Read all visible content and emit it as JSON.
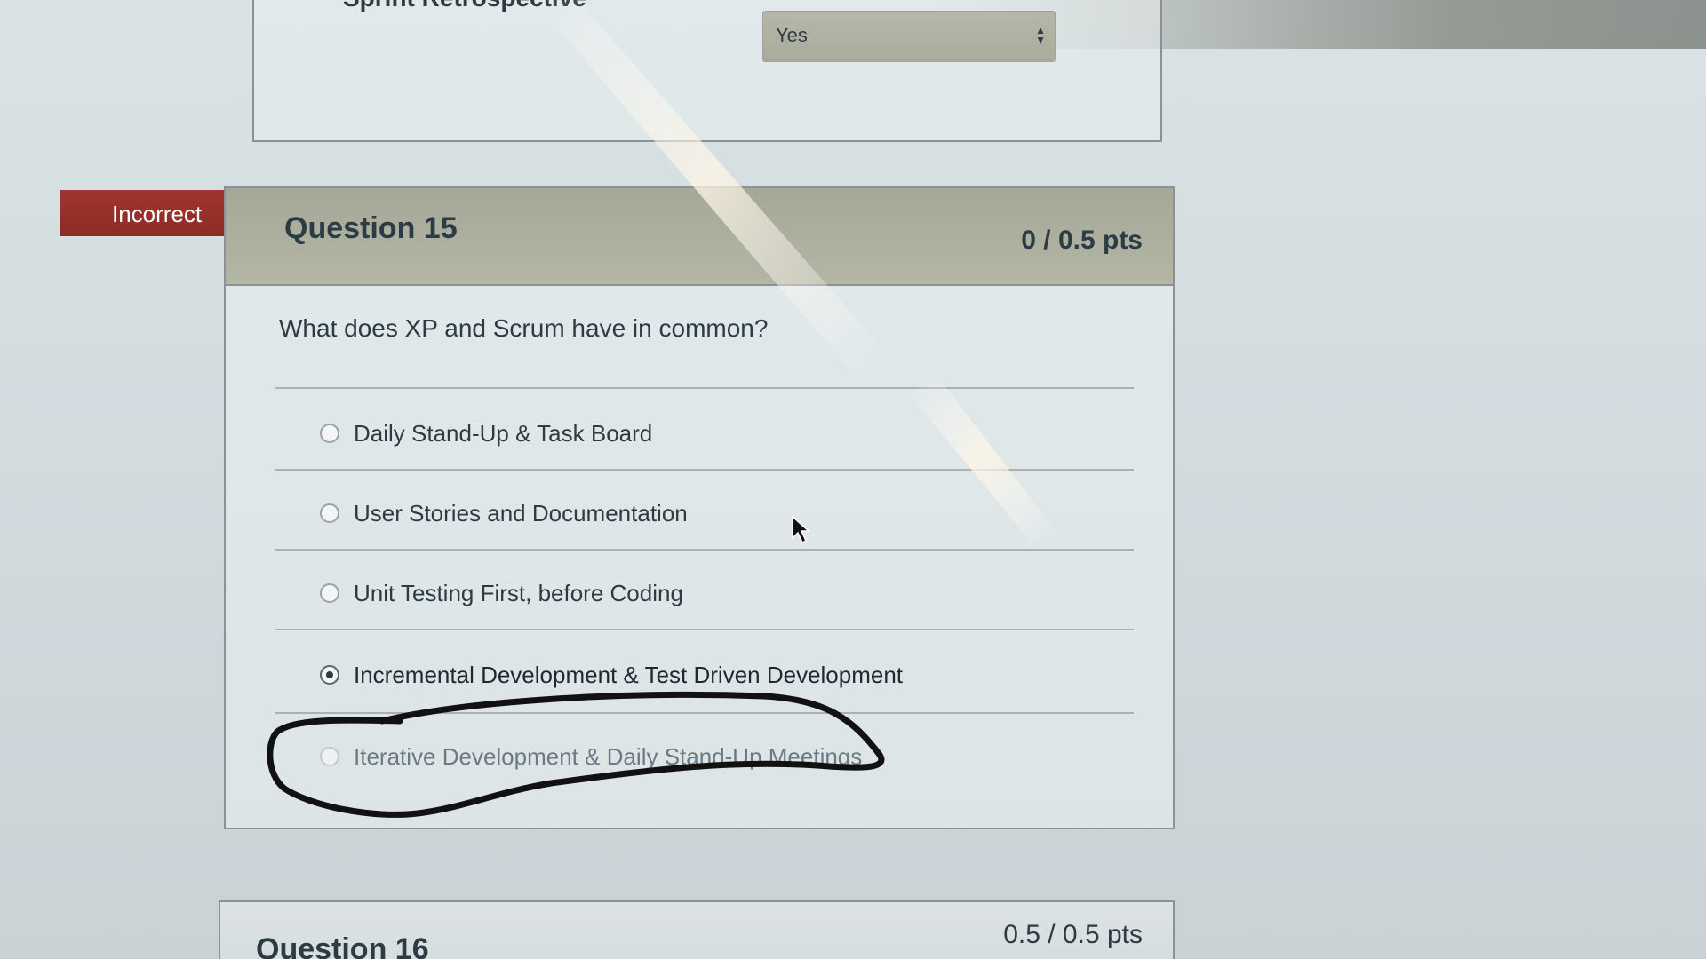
{
  "previous_question": {
    "label": "Sprint Retrospective",
    "select_value": "Yes"
  },
  "status_badge": "Incorrect",
  "question": {
    "title": "Question 15",
    "points": "0 / 0.5 pts",
    "text": "What does XP and Scrum have in common?",
    "answers": [
      {
        "label": "Daily Stand-Up & Task Board",
        "selected": false
      },
      {
        "label": "User Stories and Documentation",
        "selected": false
      },
      {
        "label": "Unit Testing First, before Coding",
        "selected": false
      },
      {
        "label": "Incremental Development & Test Driven Development",
        "selected": true
      },
      {
        "label": "Iterative Development & Daily Stand-Up Meetings",
        "selected": false
      }
    ]
  },
  "next_question": {
    "title": "Question 16",
    "points": "0.5 / 0.5 pts"
  },
  "colors": {
    "incorrect_banner": "#9b322c",
    "header_bg": "#aeb09f",
    "text": "#2d3b45",
    "annotation_ink": "#111111"
  },
  "icons": [
    "select-arrows-icon",
    "radio-icon",
    "mouse-pointer-icon"
  ]
}
